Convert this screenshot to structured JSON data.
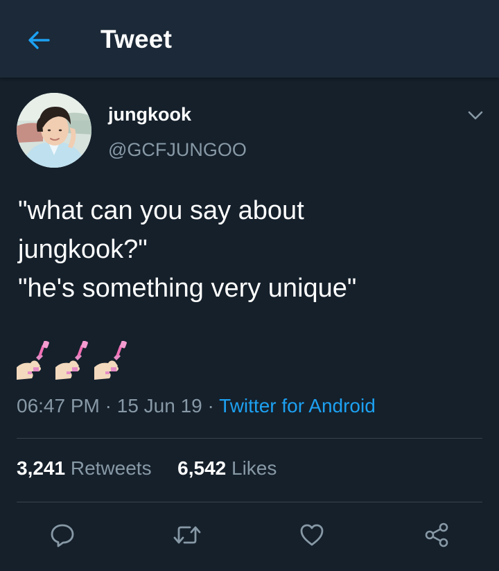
{
  "header": {
    "title": "Tweet",
    "back_icon": "arrow-left-icon",
    "accent_color": "#1da1f2"
  },
  "tweet": {
    "author": {
      "display_name": "jungkook",
      "handle": "@GCFJUNGOO"
    },
    "text_lines": [
      "\"what can you say about",
      "jungkook?\"",
      "\"he's something very unique\""
    ],
    "emojis": [
      "nail-polish-emoji",
      "nail-polish-emoji",
      "nail-polish-emoji"
    ],
    "time": "06:47 PM",
    "date": "15 Jun 19",
    "separator": " · ",
    "source": "Twitter for Android"
  },
  "stats": {
    "retweets_count": "3,241",
    "retweets_label": "Retweets",
    "likes_count": "6,542",
    "likes_label": "Likes"
  },
  "actions": [
    "reply-icon",
    "retweet-icon",
    "like-icon",
    "share-icon"
  ],
  "colors": {
    "background": "#15202b",
    "header_bg": "#1c2938",
    "secondary_text": "#8899a6",
    "divider": "#38444d"
  }
}
